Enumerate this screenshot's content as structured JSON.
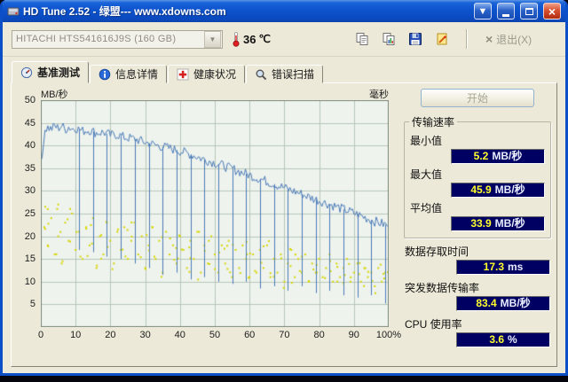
{
  "window": {
    "title": "HD Tune 2.52 - 绿盟--- www.xdowns.com",
    "buttons": {
      "down": "▼",
      "close": "×"
    }
  },
  "toolbar": {
    "drive": "HITACHI HTS541616J9S (160 GB)",
    "combo_arrow": "▼",
    "temperature_value": "36",
    "temperature_unit": "℃",
    "exit_x": "×",
    "exit_label": "退出(X)"
  },
  "tabs": [
    {
      "label": "基准测试",
      "icon": "benchmark-icon",
      "active": true
    },
    {
      "label": "信息详情",
      "icon": "info-icon",
      "active": false
    },
    {
      "label": "健康状况",
      "icon": "health-icon",
      "active": false
    },
    {
      "label": "错误扫描",
      "icon": "scan-icon",
      "active": false
    }
  ],
  "panel": {
    "start_label": "开始",
    "transfer_group": "传输速率",
    "min": {
      "label": "最小值",
      "value": "5.2",
      "unit": "MB/秒"
    },
    "max": {
      "label": "最大值",
      "value": "45.9",
      "unit": "MB/秒"
    },
    "avg": {
      "label": "平均值",
      "value": "33.9",
      "unit": "MB/秒"
    },
    "access": {
      "label": "数据存取时间",
      "value": "17.3",
      "unit": "ms"
    },
    "burst": {
      "label": "突发数据传输率",
      "value": "83.4",
      "unit": "MB/秒"
    },
    "cpu": {
      "label": "CPU 使用率",
      "value": "3.6",
      "unit": "%"
    }
  },
  "colors": {
    "value_box_bg": "#000063",
    "value_number": "#ffff2e",
    "value_unit": "#e8edff",
    "line": "#4a7ab8",
    "scatter": "#d6d600",
    "plot_bg": "#eef3ee",
    "grid": "#b7c6b7",
    "plot_border": "#7e8c7e"
  },
  "chart_data": {
    "type": "line+scatter",
    "title": "HD Tune read benchmark (transfer rate line, access time dots)",
    "y_left_label": "MB/秒",
    "y_right_label": "毫秒",
    "xlim": [
      0,
      100
    ],
    "ylim": [
      0,
      50
    ],
    "x_ticks": [
      0,
      10,
      20,
      30,
      40,
      50,
      60,
      70,
      80,
      90,
      100
    ],
    "x_tick_labels": [
      "0",
      "10",
      "20",
      "30",
      "40",
      "50",
      "60",
      "70",
      "80",
      "90",
      "100%"
    ],
    "y_ticks": [
      5,
      10,
      15,
      20,
      25,
      30,
      35,
      40,
      45,
      50
    ],
    "grid": true,
    "series": [
      {
        "name": "transfer-rate",
        "type": "line",
        "unit": "MB/秒",
        "jitter": 1.1,
        "envelope": [
          [
            0,
            35.5
          ],
          [
            0.5,
            38
          ],
          [
            1,
            43.5
          ],
          [
            2,
            44
          ],
          [
            3,
            43.6
          ],
          [
            4,
            44.3
          ],
          [
            5,
            43.8
          ],
          [
            6,
            44.4
          ],
          [
            7,
            43.5
          ],
          [
            8,
            44.1
          ],
          [
            9,
            43.7
          ],
          [
            10,
            43.9
          ],
          [
            12,
            43.2
          ],
          [
            14,
            43.4
          ],
          [
            16,
            42.8
          ],
          [
            18,
            42.9
          ],
          [
            20,
            42.3
          ],
          [
            22,
            42.4
          ],
          [
            24,
            41.8
          ],
          [
            26,
            41.6
          ],
          [
            28,
            41.2
          ],
          [
            30,
            40.7
          ],
          [
            32,
            40.3
          ],
          [
            34,
            39.9
          ],
          [
            36,
            39.6
          ],
          [
            38,
            39.2
          ],
          [
            40,
            38.8
          ],
          [
            42,
            38.3
          ],
          [
            44,
            37.8
          ],
          [
            46,
            37.2
          ],
          [
            48,
            36.7
          ],
          [
            50,
            36.2
          ],
          [
            52,
            35.7
          ],
          [
            54,
            35.1
          ],
          [
            56,
            34.6
          ],
          [
            58,
            34.0
          ],
          [
            60,
            33.5
          ],
          [
            62,
            32.9
          ],
          [
            64,
            32.4
          ],
          [
            66,
            31.8
          ],
          [
            68,
            31.2
          ],
          [
            70,
            30.7
          ],
          [
            72,
            30.1
          ],
          [
            74,
            29.6
          ],
          [
            76,
            29.0
          ],
          [
            78,
            28.4
          ],
          [
            80,
            27.9
          ],
          [
            82,
            27.3
          ],
          [
            84,
            26.8
          ],
          [
            86,
            26.2
          ],
          [
            88,
            25.7
          ],
          [
            90,
            25.1
          ],
          [
            92,
            24.5
          ],
          [
            94,
            23.9
          ],
          [
            96,
            23.3
          ],
          [
            98,
            22.8
          ],
          [
            100,
            22.3
          ]
        ],
        "dips": [
          [
            11,
            17
          ],
          [
            15,
            16.5
          ],
          [
            19,
            15.5
          ],
          [
            23,
            15
          ],
          [
            27,
            14
          ],
          [
            31,
            13
          ],
          [
            35,
            11.5
          ],
          [
            39,
            12
          ],
          [
            43,
            10.5
          ],
          [
            47,
            11
          ],
          [
            51,
            10
          ],
          [
            55,
            9.5
          ],
          [
            59,
            10
          ],
          [
            63,
            8.5
          ],
          [
            67,
            9
          ],
          [
            71,
            8
          ],
          [
            75,
            9
          ],
          [
            79,
            7.5
          ],
          [
            83,
            8
          ],
          [
            87,
            7
          ],
          [
            91,
            6.5
          ],
          [
            95,
            7
          ],
          [
            99,
            5.2
          ]
        ]
      },
      {
        "name": "access-time",
        "type": "scatter",
        "unit": "ms",
        "points": [
          [
            1,
            22
          ],
          [
            2,
            26
          ],
          [
            2,
            18
          ],
          [
            3,
            24
          ],
          [
            4,
            16
          ],
          [
            5,
            27
          ],
          [
            5,
            20
          ],
          [
            6,
            14
          ],
          [
            7,
            23
          ],
          [
            8,
            19
          ],
          [
            9,
            25
          ],
          [
            10,
            17
          ],
          [
            11,
            21
          ],
          [
            12,
            15
          ],
          [
            13,
            22
          ],
          [
            14,
            18
          ],
          [
            15,
            24
          ],
          [
            16,
            13
          ],
          [
            17,
            20
          ],
          [
            18,
            16
          ],
          [
            19,
            23
          ],
          [
            20,
            19
          ],
          [
            21,
            14
          ],
          [
            22,
            21
          ],
          [
            23,
            17
          ],
          [
            24,
            22
          ],
          [
            25,
            15
          ],
          [
            26,
            19
          ],
          [
            27,
            23
          ],
          [
            28,
            16
          ],
          [
            29,
            20
          ],
          [
            30,
            13
          ],
          [
            31,
            18
          ],
          [
            32,
            22
          ],
          [
            33,
            15
          ],
          [
            34,
            19
          ],
          [
            35,
            12
          ],
          [
            36,
            21
          ],
          [
            37,
            16
          ],
          [
            38,
            18
          ],
          [
            39,
            14
          ],
          [
            40,
            20
          ],
          [
            41,
            17
          ],
          [
            42,
            13
          ],
          [
            43,
            19
          ],
          [
            44,
            15
          ],
          [
            45,
            21
          ],
          [
            46,
            12
          ],
          [
            47,
            18
          ],
          [
            48,
            14
          ],
          [
            49,
            20
          ],
          [
            50,
            16
          ],
          [
            51,
            12
          ],
          [
            52,
            18
          ],
          [
            53,
            14
          ],
          [
            54,
            19
          ],
          [
            55,
            11
          ],
          [
            56,
            17
          ],
          [
            57,
            13
          ],
          [
            58,
            18
          ],
          [
            59,
            15
          ],
          [
            60,
            11
          ],
          [
            61,
            16
          ],
          [
            62,
            12
          ],
          [
            63,
            17
          ],
          [
            64,
            13
          ],
          [
            65,
            18
          ],
          [
            66,
            11
          ],
          [
            67,
            15
          ],
          [
            68,
            12
          ],
          [
            69,
            16
          ],
          [
            70,
            10
          ],
          [
            71,
            14
          ],
          [
            72,
            17
          ],
          [
            73,
            11
          ],
          [
            74,
            15
          ],
          [
            75,
            12
          ],
          [
            76,
            16
          ],
          [
            77,
            10
          ],
          [
            78,
            14
          ],
          [
            79,
            12
          ],
          [
            80,
            15
          ],
          [
            81,
            11
          ],
          [
            82,
            13
          ],
          [
            83,
            16
          ],
          [
            84,
            10
          ],
          [
            85,
            14
          ],
          [
            86,
            11
          ],
          [
            87,
            13
          ],
          [
            88,
            15
          ],
          [
            89,
            10
          ],
          [
            90,
            12
          ],
          [
            91,
            14
          ],
          [
            92,
            10
          ],
          [
            93,
            13
          ],
          [
            94,
            11
          ],
          [
            95,
            12
          ],
          [
            96,
            9
          ],
          [
            97,
            13
          ],
          [
            98,
            10
          ],
          [
            99,
            12
          ],
          [
            100,
            11
          ]
        ]
      }
    ]
  }
}
